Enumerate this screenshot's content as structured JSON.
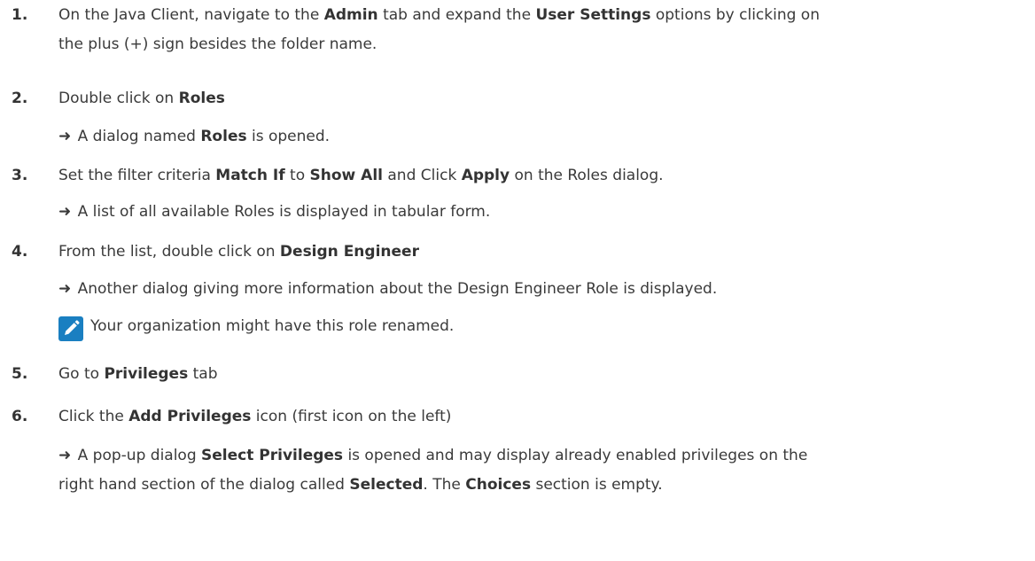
{
  "steps": [
    {
      "number": "1.",
      "line1": {
        "t1": "On the Java Client, navigate to the ",
        "b1": "Admin",
        "t2": " tab and expand the ",
        "b2": "User Settings",
        "t3": " options by clicking on"
      },
      "line2": "the plus (+) sign besides the folder name."
    },
    {
      "number": "2.",
      "text": "Double click on ",
      "bold": "Roles",
      "result": {
        "arrow": "➜",
        "t1": " A dialog named ",
        "b1": "Roles",
        "t2": " is opened."
      }
    },
    {
      "number": "3.",
      "t1": "Set the filter criteria ",
      "b1": "Match If",
      "t2": " to ",
      "b2": "Show All",
      "t3": " and Click ",
      "b3": "Apply",
      "t4": " on the Roles dialog.",
      "result": {
        "arrow": "➜",
        "text": " A list of all available Roles is displayed in tabular form."
      }
    },
    {
      "number": "4.",
      "text": "From the list, double click on ",
      "bold": "Design Engineer",
      "result": {
        "arrow": "➜",
        "text": " Another dialog giving more information about the Design Engineer Role is displayed."
      },
      "note": {
        "icon": "pencil-note-icon",
        "text": "Your organization might have this role renamed."
      }
    },
    {
      "number": "5.",
      "text": "Go to ",
      "bold": "Privileges",
      "after": " tab"
    },
    {
      "number": "6.",
      "text": "Click the ",
      "bold": "Add Privileges",
      "after": " icon (first icon on the left)",
      "result": {
        "arrow": "➜",
        "t1": " A pop-up dialog ",
        "b1": "Select Privileges",
        "t2": " is opened and may display already enabled privileges on the",
        "t3": "right hand section of the dialog called ",
        "b2": "Selected",
        "t4": ". The ",
        "b3": "Choices",
        "t5": " section is empty."
      }
    }
  ],
  "colors": {
    "text": "#3a3a3a",
    "note_icon_bg": "#1a7fc1"
  }
}
